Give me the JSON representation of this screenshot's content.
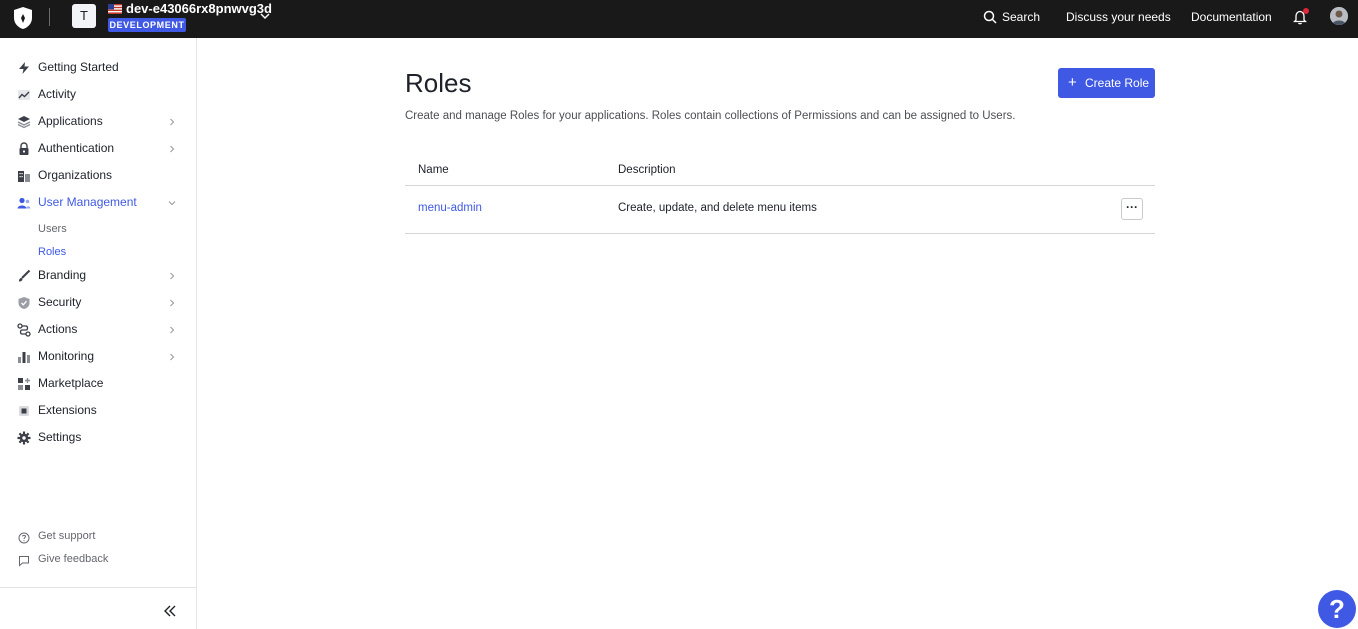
{
  "header": {
    "tenant_initial": "T",
    "tenant_name": "dev-e43066rx8pnwvg3d",
    "environment": "DEVELOPMENT",
    "search_label": "Search",
    "discuss_label": "Discuss your needs",
    "docs_label": "Documentation",
    "accent_color": "#3f59e4",
    "notification_dot_color": "#e0263b"
  },
  "sidebar": {
    "items": [
      {
        "label": "Getting Started",
        "icon": "lightning-icon",
        "has_chevron": false
      },
      {
        "label": "Activity",
        "icon": "activity-chart-icon",
        "has_chevron": false
      },
      {
        "label": "Applications",
        "icon": "layers-icon",
        "has_chevron": true
      },
      {
        "label": "Authentication",
        "icon": "lock-icon",
        "has_chevron": true
      },
      {
        "label": "Organizations",
        "icon": "buildings-icon",
        "has_chevron": false
      },
      {
        "label": "User Management",
        "icon": "users-icon",
        "has_chevron": true,
        "expanded": true,
        "active": true
      },
      {
        "label": "Branding",
        "icon": "brush-icon",
        "has_chevron": true
      },
      {
        "label": "Security",
        "icon": "shield-icon",
        "has_chevron": true
      },
      {
        "label": "Actions",
        "icon": "flow-icon",
        "has_chevron": true
      },
      {
        "label": "Monitoring",
        "icon": "bar-chart-icon",
        "has_chevron": true
      },
      {
        "label": "Marketplace",
        "icon": "grid-plus-icon",
        "has_chevron": false
      },
      {
        "label": "Extensions",
        "icon": "extension-icon",
        "has_chevron": false
      },
      {
        "label": "Settings",
        "icon": "gear-icon",
        "has_chevron": false
      }
    ],
    "sub_items": [
      {
        "label": "Users",
        "active": false
      },
      {
        "label": "Roles",
        "active": true
      }
    ],
    "footer": [
      {
        "label": "Get support",
        "icon": "question-circle-icon"
      },
      {
        "label": "Give feedback",
        "icon": "chat-bubble-icon"
      }
    ]
  },
  "main": {
    "title": "Roles",
    "description": "Create and manage Roles for your applications. Roles contain collections of Permissions and can be assigned to Users.",
    "create_button": "Create Role",
    "table": {
      "columns": [
        "Name",
        "Description"
      ],
      "rows": [
        {
          "name": "menu-admin",
          "description": "Create, update, and delete menu items"
        }
      ],
      "row_menu_label": "···"
    }
  },
  "help_button": "?"
}
